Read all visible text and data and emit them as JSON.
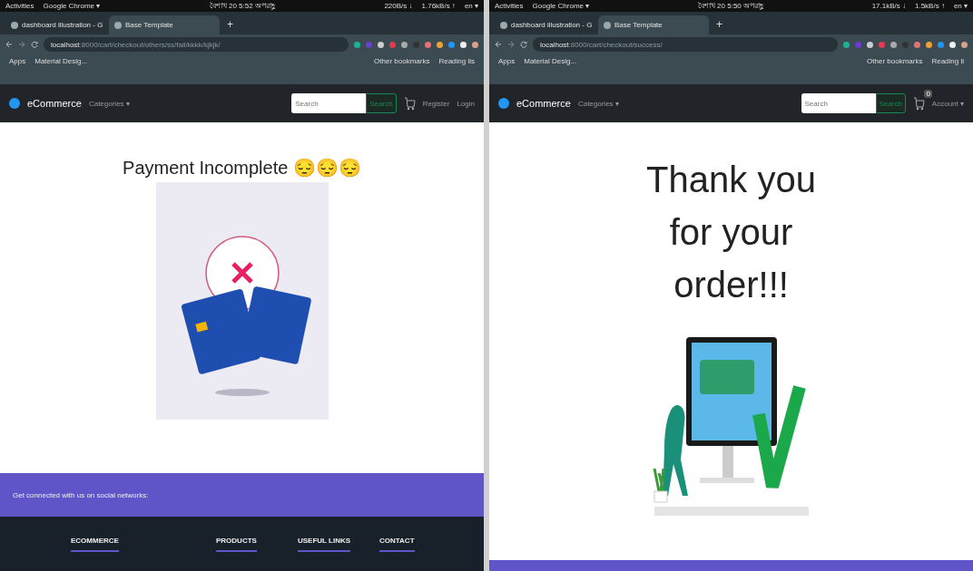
{
  "panels": [
    {
      "system_bar": {
        "activities": "Activities",
        "app_menu": "Google Chrome ▾",
        "clock": "বৈশাখ 20  5:52 অপরাহ্ণ",
        "net_down": "220B/s ↓",
        "net_up": "1.76kB/s ↑",
        "language": "en ▾"
      },
      "tabs": [
        {
          "title": "dashboard illustration - G",
          "selected": false
        },
        {
          "title": "Base Template",
          "selected": true
        }
      ],
      "new_tab": "+",
      "address": {
        "host": "localhost",
        "path": ":8000/cart/checkout/others/ss/fail/kkkk/kjkjk/"
      },
      "bookmarks": {
        "left": [
          "Apps",
          "Material Desig..."
        ],
        "right": [
          "Other bookmarks",
          "Reading lis"
        ]
      },
      "navbar": {
        "brand": "eCommerce",
        "categories": "Categories ▾",
        "search_placeholder": "Search",
        "search_button": "Search",
        "links": [
          "Register",
          "Login"
        ]
      },
      "content": {
        "kind": "payment_failed",
        "heading": "Payment Incomplete",
        "emoji": "😔😔😔"
      },
      "footer": {
        "kind": "full",
        "social_text": "Get connected with us on social networks:",
        "headings": [
          "ECOMMERCE",
          "PRODUCTS",
          "USEFUL LINKS",
          "CONTACT"
        ]
      }
    },
    {
      "system_bar": {
        "activities": "Activities",
        "app_menu": "Google Chrome ▾",
        "clock": "বৈশাখ 20  5:50 অপরাহ্ণ",
        "net_down": "17.1kB/s ↓",
        "net_up": "1.5kB/s ↑",
        "language": "en ▾"
      },
      "tabs": [
        {
          "title": "dashboard illustration - G",
          "selected": false
        },
        {
          "title": "Base Template",
          "selected": true
        }
      ],
      "new_tab": "+",
      "address": {
        "host": "localhost",
        "path": ":8000/cart/checkout/success/"
      },
      "bookmarks": {
        "left": [
          "Apps",
          "Material Desig..."
        ],
        "right": [
          "Other bookmarks",
          "Reading li"
        ]
      },
      "navbar": {
        "brand": "eCommerce",
        "categories": "Categories ▾",
        "search_placeholder": "Search",
        "search_button": "Search",
        "cart_badge": "0",
        "account": "Account ▾"
      },
      "content": {
        "kind": "order_success",
        "heading": "Thank you for your order!!!"
      },
      "footer": {
        "kind": "strip"
      }
    }
  ]
}
